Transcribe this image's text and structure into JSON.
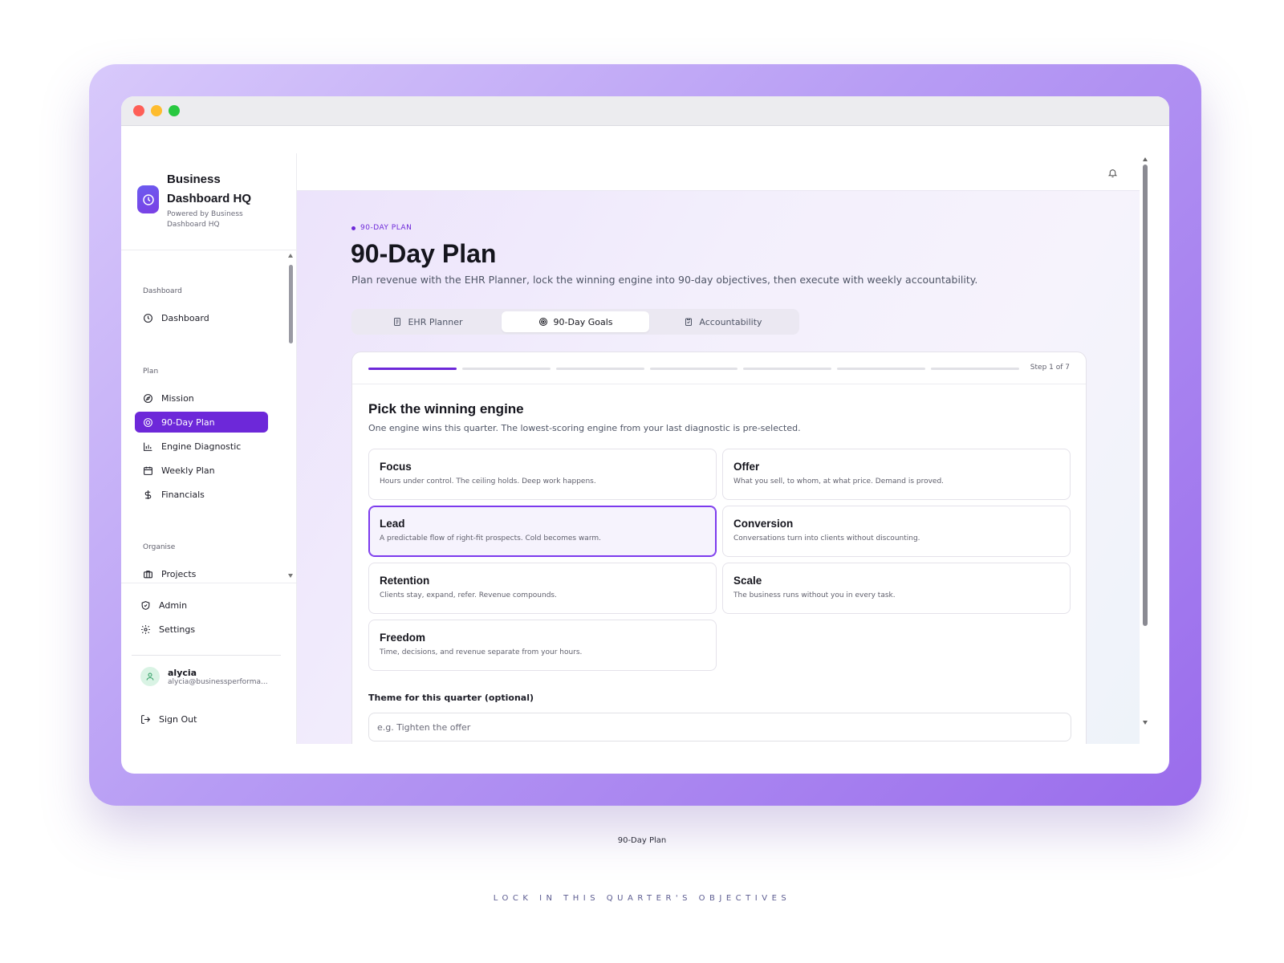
{
  "brand": {
    "title": "Business Dashboard HQ",
    "subtitle": "Powered by Business Dashboard HQ"
  },
  "nav": {
    "sections": [
      {
        "label": "Dashboard",
        "items": [
          {
            "label": "Dashboard",
            "icon": "clock-icon"
          }
        ]
      },
      {
        "label": "Plan",
        "items": [
          {
            "label": "Mission",
            "icon": "compass-icon"
          },
          {
            "label": "90-Day Plan",
            "icon": "target-icon",
            "active": true
          },
          {
            "label": "Engine Diagnostic",
            "icon": "bar-chart-icon"
          },
          {
            "label": "Weekly Plan",
            "icon": "calendar-icon"
          },
          {
            "label": "Financials",
            "icon": "dollar-icon"
          }
        ]
      },
      {
        "label": "Organise",
        "items": [
          {
            "label": "Projects",
            "icon": "briefcase-icon"
          }
        ]
      }
    ]
  },
  "footer_nav": {
    "admin": "Admin",
    "settings": "Settings"
  },
  "user": {
    "name": "alycia",
    "email": "alycia@businessperforma..."
  },
  "sign_out": "Sign Out",
  "page": {
    "eyebrow": "90-DAY PLAN",
    "title": "90-Day Plan",
    "subtitle": "Plan revenue with the EHR Planner, lock the winning engine into 90-day objectives, then execute with weekly accountability."
  },
  "tabs": [
    {
      "label": "EHR Planner",
      "icon": "document-icon",
      "active": false
    },
    {
      "label": "90-Day Goals",
      "icon": "target-icon",
      "active": true
    },
    {
      "label": "Accountability",
      "icon": "clipboard-icon",
      "active": false
    }
  ],
  "stepper": {
    "current": 1,
    "total": 7,
    "label": "Step 1 of 7"
  },
  "card": {
    "title": "Pick the winning engine",
    "subtitle": "One engine wins this quarter. The lowest-scoring engine from your last diagnostic is pre-selected."
  },
  "engines": [
    {
      "name": "Focus",
      "desc": "Hours under control. The ceiling holds. Deep work happens.",
      "selected": false
    },
    {
      "name": "Offer",
      "desc": "What you sell, to whom, at what price. Demand is proved.",
      "selected": false
    },
    {
      "name": "Lead",
      "desc": "A predictable flow of right-fit prospects. Cold becomes warm.",
      "selected": true
    },
    {
      "name": "Conversion",
      "desc": "Conversations turn into clients without discounting.",
      "selected": false
    },
    {
      "name": "Retention",
      "desc": "Clients stay, expand, refer. Revenue compounds.",
      "selected": false
    },
    {
      "name": "Scale",
      "desc": "The business runs without you in every task.",
      "selected": false
    },
    {
      "name": "Freedom",
      "desc": "Time, decisions, and revenue separate from your hours.",
      "selected": false
    }
  ],
  "theme": {
    "label": "Theme for this quarter (optional)",
    "placeholder": "e.g. Tighten the offer",
    "value": ""
  },
  "caption": "90-Day Plan",
  "tagline": "LOCK IN THIS QUARTER'S OBJECTIVES",
  "colors": {
    "accent": "#6d28d9",
    "frame_gradient_start": "#d8c9fb",
    "frame_gradient_end": "#9a6cec"
  }
}
